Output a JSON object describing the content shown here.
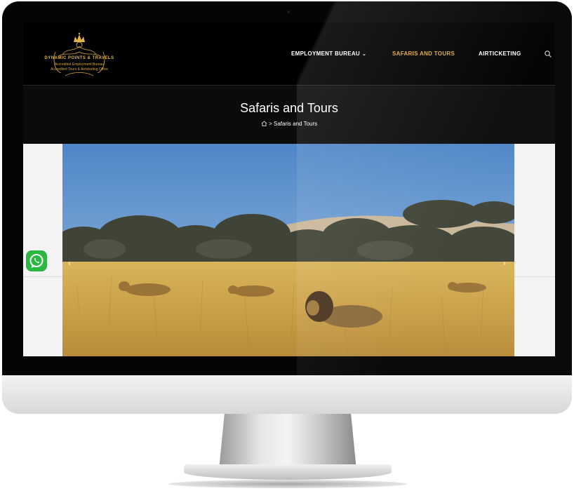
{
  "logo": {
    "name": "DYNAMIC POINTS & TRAVELS",
    "tagline1": "Accredited Employment Bureau",
    "tagline2": "Accredited Tours & Airticketing Office"
  },
  "nav": {
    "items": [
      {
        "label": "EMPLOYMENT BUREAU",
        "has_dropdown": true,
        "active": false
      },
      {
        "label": "SAFARIS AND TOURS",
        "has_dropdown": false,
        "active": true
      },
      {
        "label": "AIRTICKETING",
        "has_dropdown": false,
        "active": false
      }
    ],
    "search_icon": "search-icon"
  },
  "page_header": {
    "title": "Safaris and Tours",
    "breadcrumb_home_icon": "home-icon",
    "breadcrumb_separator": ">",
    "breadcrumb_current": "Safaris and Tours"
  },
  "slider": {
    "prev_icon": "chevron-left-icon",
    "next_icon": "chevron-right-icon"
  },
  "floating": {
    "whatsapp_icon": "whatsapp-icon"
  },
  "colors": {
    "accent": "#e0a83a",
    "header_bg": "#000000",
    "title_bar_bg": "#0b0b0b",
    "whatsapp_green": "#2cb742"
  }
}
